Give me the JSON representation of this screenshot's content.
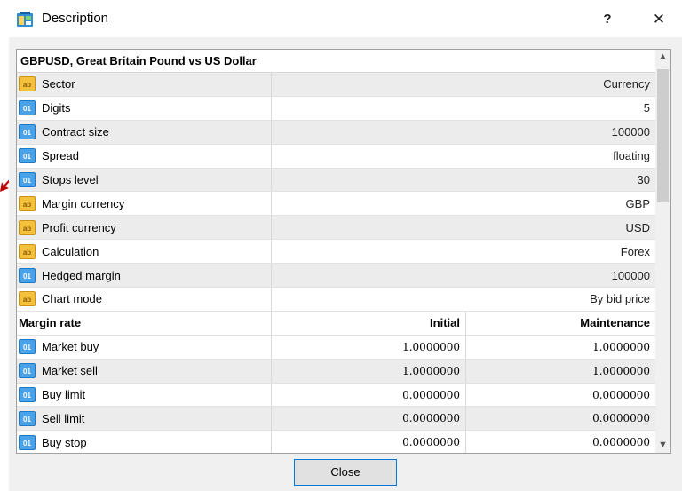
{
  "window": {
    "title": "Description",
    "help_glyph": "?",
    "close_glyph": "✕"
  },
  "symbol": {
    "heading": "GBPUSD, Great Britain Pound vs US Dollar"
  },
  "properties": [
    {
      "icon": "ab-text-icon",
      "label": "Sector",
      "value": "Currency"
    },
    {
      "icon": "01-numeric-icon",
      "label": "Digits",
      "value": "5"
    },
    {
      "icon": "01-numeric-icon",
      "label": "Contract size",
      "value": "100000"
    },
    {
      "icon": "01-numeric-icon",
      "label": "Spread",
      "value": "floating"
    },
    {
      "icon": "01-numeric-icon",
      "label": "Stops level",
      "value": "30"
    },
    {
      "icon": "ab-text-icon",
      "label": "Margin currency",
      "value": "GBP"
    },
    {
      "icon": "ab-text-icon",
      "label": "Profit currency",
      "value": "USD"
    },
    {
      "icon": "ab-text-icon",
      "label": "Calculation",
      "value": "Forex"
    },
    {
      "icon": "01-numeric-icon",
      "label": "Hedged margin",
      "value": "100000"
    },
    {
      "icon": "ab-text-icon",
      "label": "Chart mode",
      "value": "By bid price"
    }
  ],
  "margin": {
    "header": {
      "label": "Margin rate",
      "initial": "Initial",
      "maintenance": "Maintenance"
    },
    "rows": [
      {
        "label": "Market buy",
        "initial": "1.0000000",
        "maintenance": "1.0000000"
      },
      {
        "label": "Market sell",
        "initial": "1.0000000",
        "maintenance": "1.0000000"
      },
      {
        "label": "Buy limit",
        "initial": "0.0000000",
        "maintenance": "0.0000000"
      },
      {
        "label": "Sell limit",
        "initial": "0.0000000",
        "maintenance": "0.0000000"
      },
      {
        "label": "Buy stop",
        "initial": "0.0000000",
        "maintenance": "0.0000000"
      }
    ]
  },
  "buttons": {
    "close": "Close"
  },
  "colors": {
    "accent": "#0078d7",
    "arrow": "#c00000"
  }
}
